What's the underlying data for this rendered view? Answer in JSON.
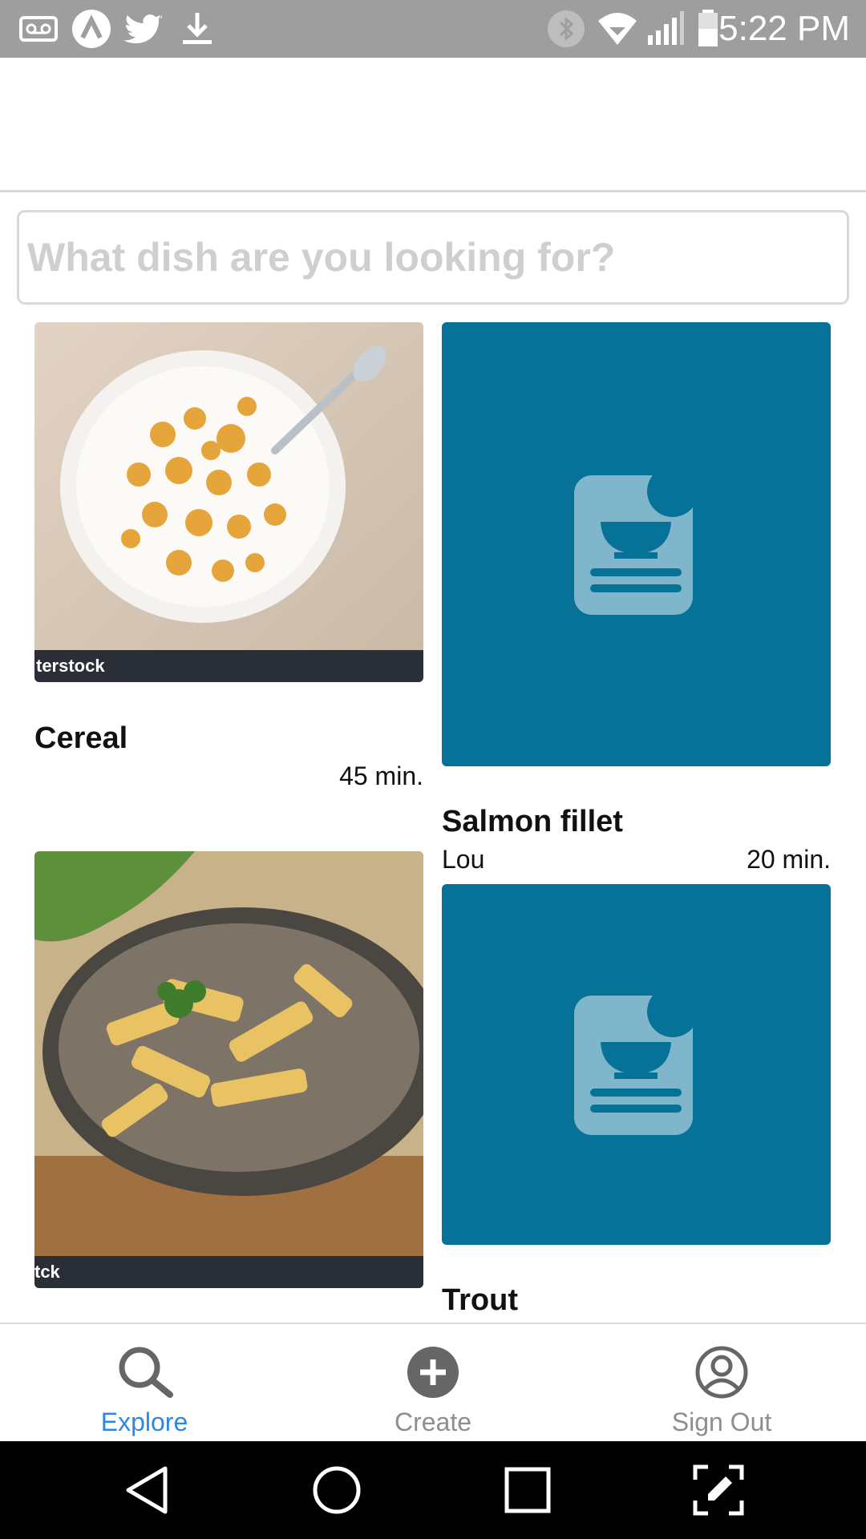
{
  "status_bar": {
    "time": "5:22 PM",
    "left_icons": [
      "voicemail-icon",
      "app-icon",
      "twitter-icon",
      "download-icon"
    ],
    "right_icons": [
      "bluetooth-icon",
      "wifi-icon",
      "signal-icon",
      "battery-icon"
    ]
  },
  "search": {
    "placeholder": "What dish are you looking for?",
    "value": ""
  },
  "recipes": [
    {
      "title": "Cereal",
      "author": "",
      "time": "45 min.",
      "image": "photo",
      "watermark": "terstock"
    },
    {
      "title": "Salmon fillet",
      "author": "Lou",
      "time": "20 min.",
      "image": "placeholder-recipe-icon"
    },
    {
      "title": "",
      "author": "",
      "time": "",
      "image": "photo",
      "watermark": "tck"
    },
    {
      "title": "Trout",
      "author": "",
      "time": "",
      "image": "placeholder-recipe-icon"
    }
  ],
  "tabs": [
    {
      "label": "Explore",
      "icon": "search-icon",
      "active": true
    },
    {
      "label": "Create",
      "icon": "add-circle-icon",
      "active": false
    },
    {
      "label": "Sign Out",
      "icon": "account-circle-icon",
      "active": false
    }
  ],
  "colors": {
    "status_bar": "#9e9e9e",
    "placeholder_tile": "#077297",
    "placeholder_icon": "#80b6cc",
    "tab_active": "#2f86e4",
    "tab_inactive": "#8e8e8e"
  }
}
